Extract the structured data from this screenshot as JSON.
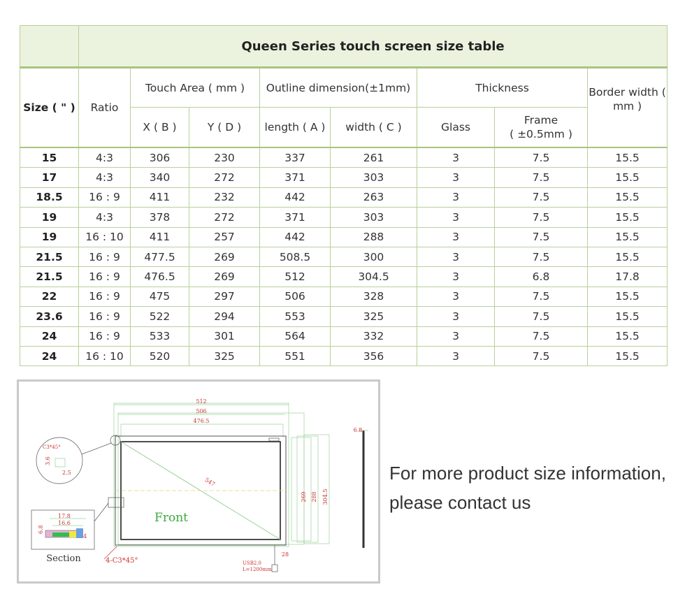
{
  "table": {
    "title": "Queen Series touch screen size table",
    "headers": {
      "size": "Size ( \" )",
      "ratio": "Ratio",
      "touch_area": "Touch Area ( mm )",
      "outline": "Outline dimension(±1mm)",
      "thickness": "Thickness",
      "border": "Border width ( mm )",
      "x": "X ( B )",
      "y": "Y ( D )",
      "length": "length ( A )",
      "width": "width ( C )",
      "glass": "Glass",
      "frame_1": "Frame",
      "frame_2": "( ±0.5mm )"
    },
    "rows": [
      [
        "15",
        "4:3",
        "306",
        "230",
        "337",
        "261",
        "3",
        "7.5",
        "15.5"
      ],
      [
        "17",
        "4:3",
        "340",
        "272",
        "371",
        "303",
        "3",
        "7.5",
        "15.5"
      ],
      [
        "18.5",
        "16 : 9",
        "411",
        "232",
        "442",
        "263",
        "3",
        "7.5",
        "15.5"
      ],
      [
        "19",
        "4:3",
        "378",
        "272",
        "371",
        "303",
        "3",
        "7.5",
        "15.5"
      ],
      [
        "19",
        "16 : 10",
        "411",
        "257",
        "442",
        "288",
        "3",
        "7.5",
        "15.5"
      ],
      [
        "21.5",
        "16 : 9",
        "477.5",
        "269",
        "508.5",
        "300",
        "3",
        "7.5",
        "15.5"
      ],
      [
        "21.5",
        "16 : 9",
        "476.5",
        "269",
        "512",
        "304.5",
        "3",
        "6.8",
        "17.8"
      ],
      [
        "22",
        "16 : 9",
        "475",
        "297",
        "506",
        "328",
        "3",
        "7.5",
        "15.5"
      ],
      [
        "23.6",
        "16 : 9",
        "522",
        "294",
        "553",
        "325",
        "3",
        "7.5",
        "15.5"
      ],
      [
        "24",
        "16 : 9",
        "533",
        "301",
        "564",
        "332",
        "3",
        "7.5",
        "15.5"
      ],
      [
        "24",
        "16 : 10",
        "520",
        "325",
        "551",
        "356",
        "3",
        "7.5",
        "15.5"
      ]
    ]
  },
  "drawing": {
    "dim_512": "512",
    "dim_506": "506",
    "dim_476": "476.5",
    "dim_269": "269",
    "dim_288": "288",
    "dim_304": "304.5",
    "dim_547": "547",
    "dim_68": "6.8",
    "dim_28": "28",
    "front": "Front",
    "usb": "USB2.0",
    "cable": "L=1200mm",
    "chamfer": "4-C3*45°",
    "detail_chamfer": "C3*45°",
    "detail_36": "3.6",
    "detail_25": "2.5",
    "sec_178": "17.8",
    "sec_166": "16.6",
    "sec_68": "6.8",
    "sec_4": "4",
    "section": "Section"
  },
  "contact": {
    "line1": "For more product size information,",
    "line2": "please contact us"
  }
}
